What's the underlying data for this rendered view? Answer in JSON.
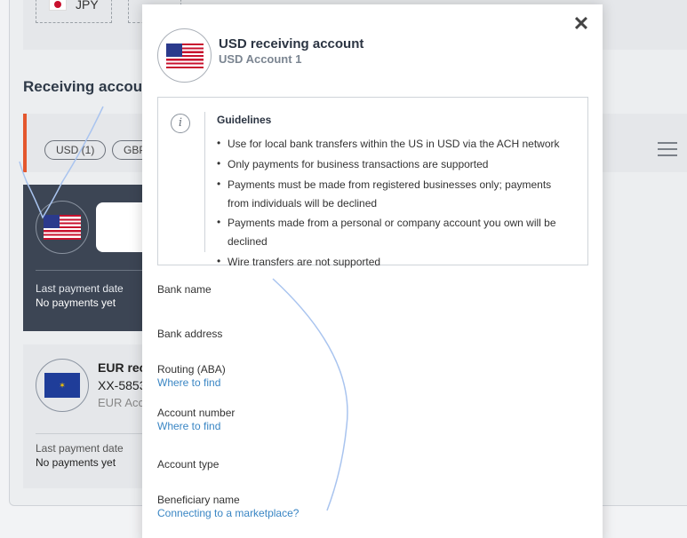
{
  "background": {
    "currency_chip": "JPY",
    "section_heading": "Receiving accounts",
    "filter_pills": [
      "USD (1)",
      "GBP"
    ],
    "usd_card": {
      "last_payment_label": "Last payment date",
      "last_payment_value": "No payments yet"
    },
    "eur_card": {
      "title": "EUR rec",
      "account_number": "XX-5853",
      "subtitle": "EUR Acc",
      "last_payment_label": "Last payment date",
      "last_payment_value": "No payments yet"
    }
  },
  "modal": {
    "title": "USD receiving account",
    "subtitle": "USD Account 1",
    "close_label": "✕",
    "guidelines": {
      "title": "Guidelines",
      "items": [
        "Use for local bank transfers within the US in USD via the ACH network",
        "Only payments for business transactions are supported",
        "Payments must be made from registered businesses only; payments from individuals will be declined",
        "Payments made from a personal or company account you own will be declined",
        "Wire transfers are not supported"
      ]
    },
    "fields": [
      {
        "label": "Bank name",
        "link": ""
      },
      {
        "label": "Bank address",
        "link": ""
      },
      {
        "label": "Routing (ABA)",
        "link": "Where to find"
      },
      {
        "label": "Account number",
        "link": "Where to find"
      },
      {
        "label": "Account type",
        "link": ""
      },
      {
        "label": "Beneficiary name",
        "link": "Connecting to a marketplace?"
      }
    ]
  },
  "colors": {
    "accent_link": "#3a86c4",
    "active_card": "#3c4554",
    "filter_accent": "#e4572e",
    "scribble": "#a9c4ef"
  },
  "icons": [
    "us-flag-icon",
    "jp-flag-icon",
    "eu-flag-icon",
    "info-icon",
    "close-icon",
    "list-view-icon"
  ]
}
